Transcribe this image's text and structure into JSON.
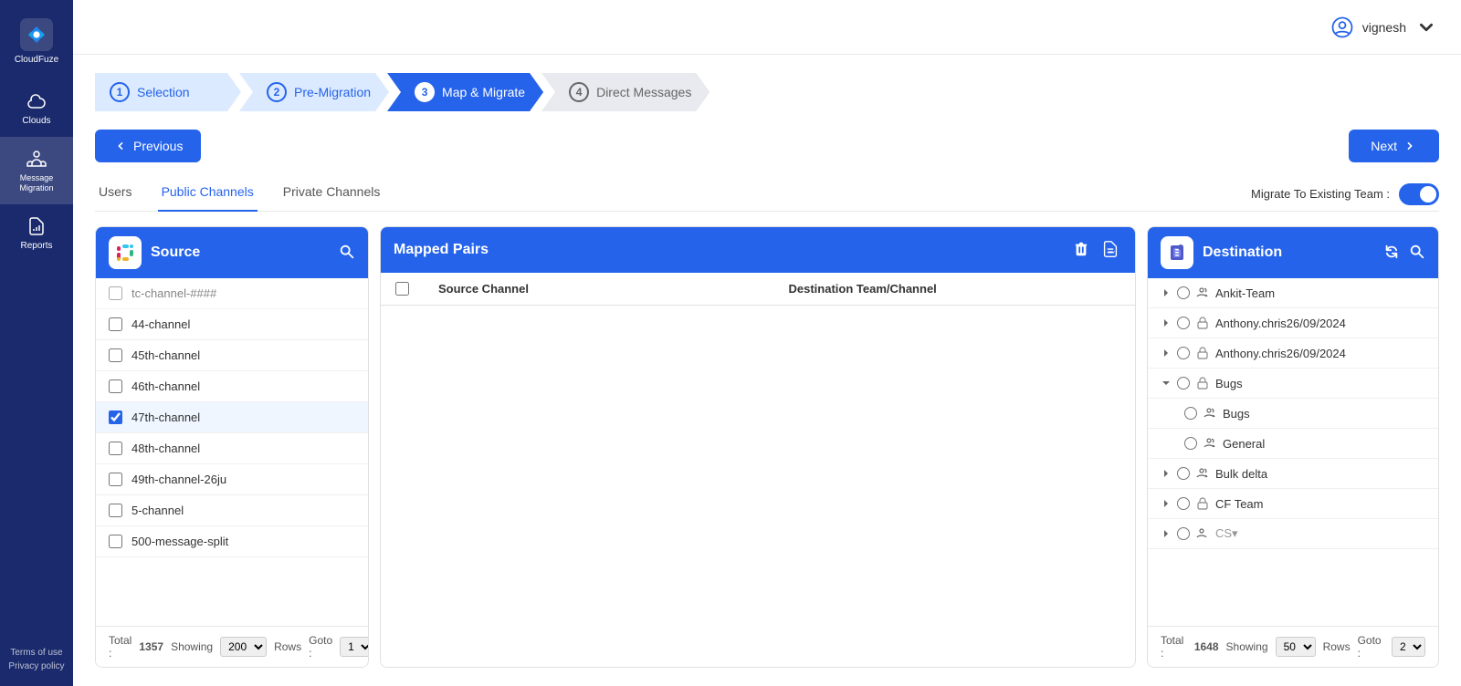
{
  "app": {
    "name": "CloudFuze"
  },
  "sidebar": {
    "items": [
      {
        "id": "clouds",
        "label": "Clouds"
      },
      {
        "id": "message-migration",
        "label": "Message Migration"
      },
      {
        "id": "reports",
        "label": "Reports"
      }
    ],
    "bottom_links": [
      {
        "label": "Terms of use"
      },
      {
        "label": "Privacy policy"
      }
    ]
  },
  "topbar": {
    "user_name": "vignesh"
  },
  "stepper": {
    "steps": [
      {
        "num": "1",
        "label": "Selection",
        "state": "completed"
      },
      {
        "num": "2",
        "label": "Pre-Migration",
        "state": "completed"
      },
      {
        "num": "3",
        "label": "Map & Migrate",
        "state": "active"
      },
      {
        "num": "4",
        "label": "Direct Messages",
        "state": "inactive"
      }
    ]
  },
  "nav": {
    "previous_label": "Previous",
    "next_label": "Next"
  },
  "tabs": {
    "items": [
      {
        "id": "users",
        "label": "Users",
        "active": false
      },
      {
        "id": "public-channels",
        "label": "Public Channels",
        "active": true
      },
      {
        "id": "private-channels",
        "label": "Private Channels",
        "active": false
      }
    ],
    "migrate_toggle_label": "Migrate To Existing Team :"
  },
  "source_panel": {
    "title": "Source",
    "channels": [
      {
        "name": "tc-channel-####",
        "checked": false,
        "visible": true,
        "partial": true
      },
      {
        "name": "44-channel",
        "checked": false
      },
      {
        "name": "45th-channel",
        "checked": false
      },
      {
        "name": "46th-channel",
        "checked": false
      },
      {
        "name": "47th-channel",
        "checked": true
      },
      {
        "name": "48th-channel",
        "checked": false
      },
      {
        "name": "49th-channel-26ju",
        "checked": false
      },
      {
        "name": "5-channel",
        "checked": false
      },
      {
        "name": "500-message-split",
        "checked": false
      }
    ],
    "footer": {
      "total_label": "Total :",
      "total_value": "1357",
      "showing_label": "Showing",
      "rows_label": "Rows",
      "goto_label": "Goto :",
      "rows_options": [
        "200"
      ],
      "goto_options": [
        "1"
      ],
      "rows_selected": "200",
      "goto_selected": "1"
    }
  },
  "mapped_panel": {
    "title": "Mapped Pairs",
    "col_source": "Source Channel",
    "col_dest": "Destination Team/Channel"
  },
  "dest_panel": {
    "title": "Destination",
    "items": [
      {
        "id": "ankit-team",
        "label": "Ankit-Team",
        "expanded": false,
        "indent": 0,
        "lock": false,
        "type": "group"
      },
      {
        "id": "anthony1",
        "label": "Anthony.chris26/09/2024",
        "expanded": false,
        "indent": 0,
        "lock": true,
        "type": "group"
      },
      {
        "id": "anthony2",
        "label": "Anthony.chris26/09/2024",
        "expanded": false,
        "indent": 0,
        "lock": true,
        "type": "group"
      },
      {
        "id": "bugs",
        "label": "Bugs",
        "expanded": true,
        "indent": 0,
        "lock": true,
        "type": "group"
      },
      {
        "id": "bugs-sub",
        "label": "Bugs",
        "expanded": false,
        "indent": 1,
        "lock": false,
        "type": "group"
      },
      {
        "id": "general",
        "label": "General",
        "expanded": false,
        "indent": 1,
        "lock": false,
        "type": "group"
      },
      {
        "id": "bulk-delta",
        "label": "Bulk delta",
        "expanded": false,
        "indent": 0,
        "lock": false,
        "type": "group"
      },
      {
        "id": "cf-team",
        "label": "CF Team",
        "expanded": false,
        "indent": 0,
        "lock": true,
        "type": "group"
      },
      {
        "id": "csv-etc",
        "label": "CS▾",
        "expanded": false,
        "indent": 0,
        "lock": false,
        "type": "group"
      }
    ],
    "footer": {
      "total_label": "Total :",
      "total_value": "1648",
      "showing_label": "Showing",
      "rows_label": "Rows",
      "goto_label": "Goto :",
      "rows_options": [
        "50"
      ],
      "goto_options": [
        "2"
      ],
      "rows_selected": "50",
      "goto_selected": "2"
    }
  }
}
